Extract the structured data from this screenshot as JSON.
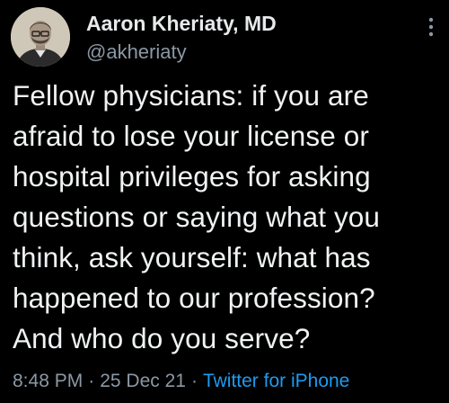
{
  "tweet": {
    "author": {
      "name": "Aaron Kheriaty, MD",
      "handle": "@akheriaty",
      "avatar_icon": "profile-photo"
    },
    "more_icon": "more-vertical-icon",
    "text": "Fellow physicians: if you are\nafraid to lose your license or\nhospital privileges for asking\nquestions or saying what you\nthink, ask yourself: what has\nhappened to our profession?\nAnd who do you serve?",
    "meta": {
      "time": "8:48 PM",
      "separator": "·",
      "date": "25 Dec 21",
      "source": "Twitter for iPhone"
    },
    "colors": {
      "background": "#000000",
      "primary_text": "#e7e9ea",
      "secondary_text": "#8b98a5",
      "accent": "#1d9bf0"
    }
  }
}
